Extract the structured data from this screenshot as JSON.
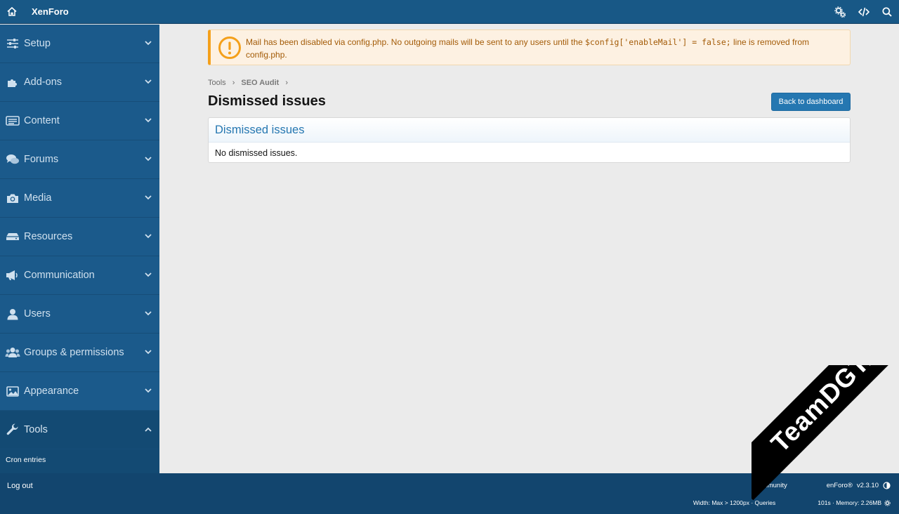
{
  "header": {
    "brand": "XenForo",
    "icons": [
      "home-icon",
      "settings-cogs-icon",
      "code-icon",
      "search-icon"
    ]
  },
  "sidebar": {
    "items": [
      {
        "label": "Setup",
        "icon": "sliders-icon"
      },
      {
        "label": "Add-ons",
        "icon": "puzzle-icon"
      },
      {
        "label": "Content",
        "icon": "content-icon"
      },
      {
        "label": "Forums",
        "icon": "comments-icon"
      },
      {
        "label": "Media",
        "icon": "camera-icon"
      },
      {
        "label": "Resources",
        "icon": "hdd-icon"
      },
      {
        "label": "Communication",
        "icon": "megaphone-icon"
      },
      {
        "label": "Users",
        "icon": "user-icon"
      },
      {
        "label": "Groups & permissions",
        "icon": "users-icon"
      },
      {
        "label": "Appearance",
        "icon": "image-icon"
      },
      {
        "label": "Tools",
        "icon": "wrench-icon"
      }
    ],
    "tools_sub": "Cron entries"
  },
  "notice": {
    "text_before": "Mail has been disabled via config.php. No outgoing mails will be sent to any users until the ",
    "code": "$config['enableMail'] = false;",
    "text_after": " line is removed from config.php."
  },
  "breadcrumb": {
    "items": [
      "Tools",
      "SEO Audit"
    ]
  },
  "page": {
    "title": "Dismissed issues",
    "back_button": "Back to dashboard"
  },
  "block": {
    "header": "Dismissed issues",
    "body": "No dismissed issues."
  },
  "footer": {
    "logout": "Log out",
    "credits_left": "Community",
    "credits_right": "enForo®",
    "version": "v2.3.10",
    "debug_left": "Width: Max > 1200px · Queries",
    "debug_right": "101s · Memory: 2.26MB"
  },
  "watermark": "TeamDGT.org",
  "colors": {
    "header_bg": "#185886",
    "sidebar_bg": "#1b5a8b",
    "accent": "#2577b1",
    "notice_bg": "#fdf1e2",
    "notice_text": "#a35b07"
  }
}
